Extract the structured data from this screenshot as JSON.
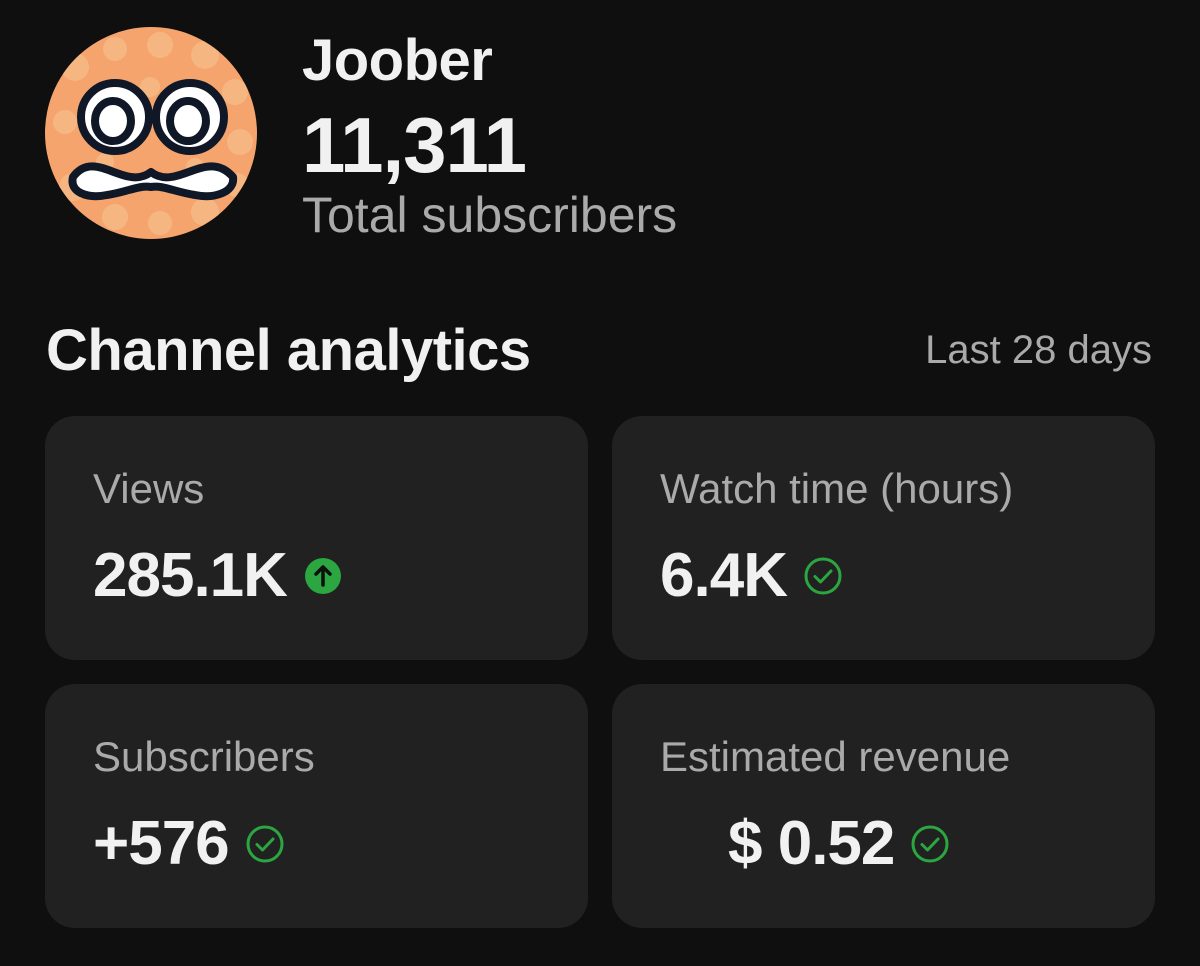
{
  "channel": {
    "name": "Joober",
    "subscriber_count": "11,311",
    "subscriber_label": "Total subscribers",
    "avatar_icon": "googly-eyes-mustache-face-icon"
  },
  "analytics": {
    "title": "Channel analytics",
    "period": "Last 28 days",
    "metrics": [
      {
        "label": "Views",
        "value": "285.1K",
        "status": "above-typical",
        "status_icon": "arrow-up-circle-icon"
      },
      {
        "label": "Watch time (hours)",
        "value": "6.4K",
        "status": "typical",
        "status_icon": "check-circle-icon"
      },
      {
        "label": "Subscribers",
        "value": "+576",
        "status": "typical",
        "status_icon": "check-circle-icon"
      },
      {
        "label": "Estimated revenue",
        "value": "$ 0.52",
        "status": "typical",
        "status_icon": "check-circle-icon"
      }
    ]
  },
  "colors": {
    "background": "#0f0f0f",
    "card": "#212121",
    "text_primary": "#f1f1f1",
    "text_secondary": "#aaaaaa",
    "status_green": "#2ba640",
    "avatar_orange": "#f4a46c"
  }
}
